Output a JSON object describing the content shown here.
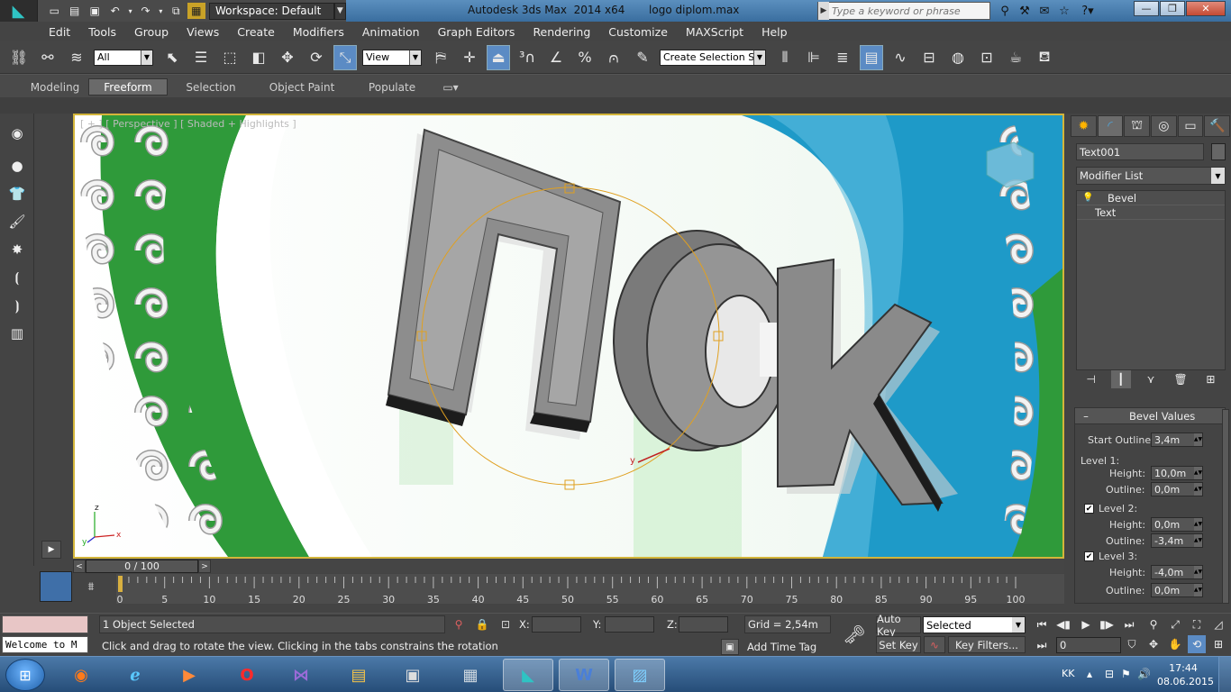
{
  "app": {
    "title": "Autodesk 3ds Max  2014 x64       logo diplom.max",
    "workspace": "Workspace: Default",
    "search_placeholder": "Type a keyword or phrase"
  },
  "menu": [
    "Edit",
    "Tools",
    "Group",
    "Views",
    "Create",
    "Modifiers",
    "Animation",
    "Graph Editors",
    "Rendering",
    "Customize",
    "MAXScript",
    "Help"
  ],
  "toolbar": {
    "selection_filter": "All",
    "reference_coord": "View",
    "named_selection": "Create Selection Se"
  },
  "ribbon_tabs": [
    "Modeling",
    "Freeform",
    "Selection",
    "Object Paint",
    "Populate"
  ],
  "viewport": {
    "label": "[ + ] [ Perspective ] [ Shaded + Highlights ]",
    "axis_x": "x",
    "axis_y": "y",
    "axis_z": "z"
  },
  "command_panel": {
    "object_name": "Text001",
    "modifier_list": "Modifier List",
    "stack": [
      "Bevel",
      "Text"
    ],
    "rollout_title": "Bevel Values",
    "start_outline_label": "Start Outline:",
    "start_outline": "3,4m",
    "level1_label": "Level 1:",
    "level1_height_label": "Height:",
    "level1_height": "10,0m",
    "level1_outline_label": "Outline:",
    "level1_outline": "0,0m",
    "level2_label": "Level 2:",
    "level2_checked": true,
    "level2_height_label": "Height:",
    "level2_height": "0,0m",
    "level2_outline_label": "Outline:",
    "level2_outline": "-3,4m",
    "level3_label": "Level 3:",
    "level3_checked": true,
    "level3_height_label": "Height:",
    "level3_height": "-4,0m",
    "level3_outline_label": "Outline:",
    "level3_outline": "0,0m"
  },
  "timeline": {
    "frame_display": "0 / 100",
    "ticks": [
      "0",
      "5",
      "10",
      "15",
      "20",
      "25",
      "30",
      "35",
      "40",
      "45",
      "50",
      "55",
      "60",
      "65",
      "70",
      "75",
      "80",
      "85",
      "90",
      "95",
      "100"
    ]
  },
  "status": {
    "welcome": "Welcome to M",
    "selection": "1 Object Selected",
    "prompt": "Click and drag to rotate the view.  Clicking in the tabs constrains the rotation",
    "x_label": "X:",
    "y_label": "Y:",
    "z_label": "Z:",
    "grid": "Grid = 2,54m",
    "add_time_tag": "Add Time Tag",
    "auto_key": "Auto Key",
    "set_key": "Set Key",
    "key_filter": "Selected",
    "key_filters_btn": "Key Filters...",
    "current_frame": "0"
  },
  "taskbar": {
    "lang": "KK",
    "time": "17:44",
    "date": "08.06.2015",
    "apps": [
      "firefox",
      "internet-explorer",
      "media-player",
      "opera",
      "visual-studio",
      "file-explorer",
      "windows-explorer",
      "calculator",
      "3ds-max",
      "word",
      "image-viewer"
    ]
  },
  "colors": {
    "viewport_border": "#d3b53a",
    "logo_green": "#2f9a3a",
    "logo_blue": "#1e9ac8",
    "selection_circle": "#e0a020"
  }
}
